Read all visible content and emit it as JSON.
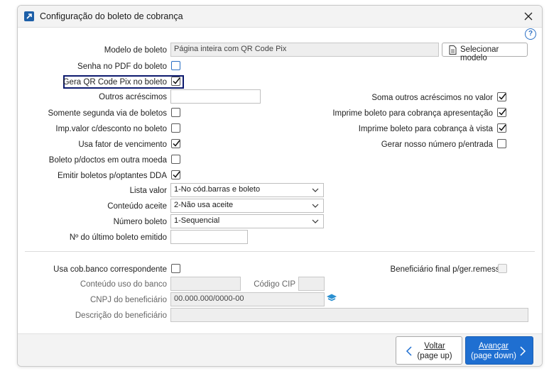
{
  "window": {
    "title": "Configuração do boleto de cobrança"
  },
  "form": {
    "modelo_label": "Modelo de boleto",
    "modelo_value": "Página inteira com QR Code Pix",
    "selecionar_label": "Selecionar modelo",
    "senha_pdf_label": "Senha no PDF do boleto",
    "gera_qr_label": "Gera QR Code Pix no boleto",
    "outros_label": "Outros acréscimos",
    "outros_value": "",
    "soma_label": "Soma outros acréscimos no valor",
    "segunda_via_label": "Somente segunda via de boletos",
    "imprime_apresentacao_label": "Imprime boleto para cobrança apresentação",
    "imp_valor_label": "Imp.valor c/desconto no boleto",
    "imprime_vista_label": "Imprime boleto para cobrança à vista",
    "fator_label": "Usa fator de vencimento",
    "nosso_numero_label": "Gerar nosso número p/entrada",
    "outra_moeda_label": "Boleto p/doctos em outra moeda",
    "dda_label": "Emitir boletos p/optantes DDA",
    "lista_label": "Lista valor",
    "lista_value": "1-No cód.barras e boleto",
    "aceite_label": "Conteúdo aceite",
    "aceite_value": "2-Não usa aceite",
    "numero_label": "Número boleto",
    "numero_value": "1-Sequencial",
    "ultimo_label": "Nº do último boleto emitido",
    "ultimo_value": ""
  },
  "checks": {
    "senha_pdf": false,
    "gera_qr": true,
    "soma": true,
    "segunda_via": false,
    "imprime_apresentacao": true,
    "imp_valor": false,
    "imprime_vista": true,
    "fator": true,
    "nosso_numero": false,
    "outra_moeda": false,
    "dda": true,
    "cob_banco": false,
    "beneficiario_final": false
  },
  "banco": {
    "cob_banco_label": "Usa cob.banco correspondente",
    "beneficiario_final_label": "Beneficiário final p/ger.remessa",
    "conteudo_uso_label": "Conteúdo uso do banco",
    "conteudo_uso_value": "",
    "codigo_cip_label": "Código CIP",
    "codigo_cip_value": "",
    "cnpj_label": "CNPJ do beneficiário",
    "cnpj_value": "00.000.000/0000-00",
    "descricao_label": "Descrição do beneficiário",
    "descricao_value": ""
  },
  "footer": {
    "voltar_label": "Voltar",
    "voltar_hint": "(page up)",
    "avancar_label": "Avançar",
    "avancar_hint": "(page down)"
  },
  "icons": {
    "app": "app-arrow-icon",
    "close": "close-icon",
    "help": "help-icon",
    "document": "document-icon",
    "search": "search-icon",
    "back": "chevron-left-icon",
    "next": "chevron-right-icon"
  },
  "colors": {
    "accent": "#1f6fd1",
    "highlight_border": "#0d1a6e"
  }
}
